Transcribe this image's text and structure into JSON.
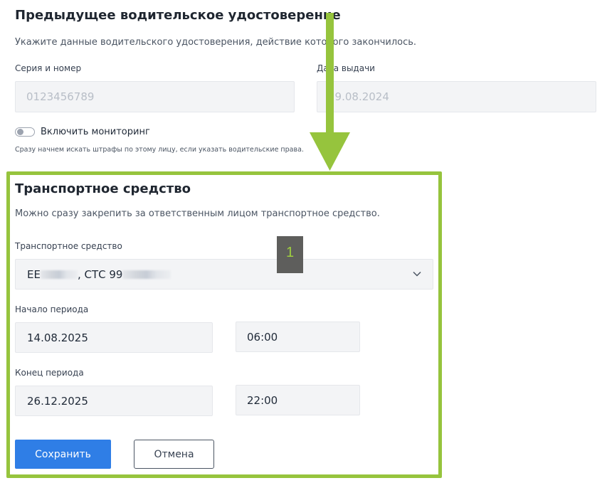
{
  "previous_license": {
    "title": "Предыдущее водительское удостоверение",
    "description": "Укажите данные водительского удостоверения, действие которого закончилось.",
    "series_number": {
      "label": "Серия и номер",
      "placeholder": "0123456789"
    },
    "issue_date": {
      "label": "Дата выдачи",
      "placeholder": "29.08.2024"
    },
    "monitoring": {
      "label": "Включить мониторинг",
      "enabled": false,
      "note": "Сразу начнем искать штрафы по этому лицу, если указать водительские права."
    }
  },
  "vehicle": {
    "title": "Транспортное средство",
    "description": "Можно сразу закрепить за ответственным лицом транспортное средство.",
    "vehicle_select": {
      "label": "Транспортное средство",
      "value_prefix": "ЕЕ",
      "value_middle": ", СТС 99"
    },
    "period_start": {
      "label": "Начало периода",
      "date": "14.08.2025",
      "time": "06:00"
    },
    "period_end": {
      "label": "Конец периода",
      "date": "26.12.2025",
      "time": "22:00"
    },
    "save_label": "Сохранить",
    "cancel_label": "Отмена"
  },
  "annotation": {
    "step_number": "1",
    "accent_color": "#96c43d"
  },
  "colors": {
    "primary_button": "#2f7ee6",
    "field_background": "#f3f4f6"
  }
}
